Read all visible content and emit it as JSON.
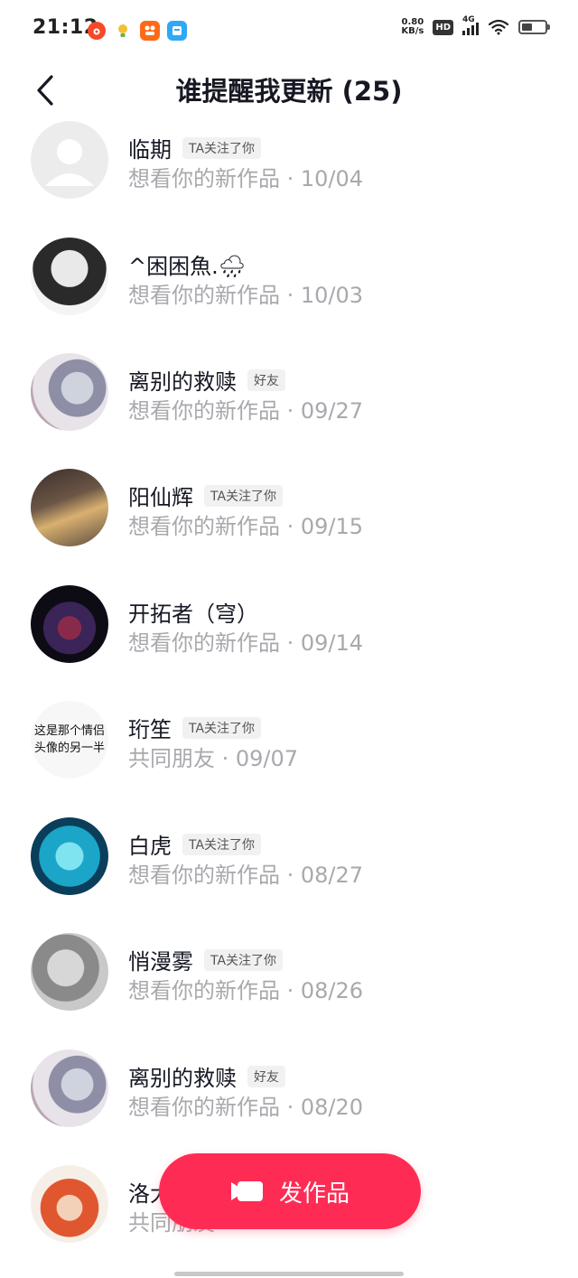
{
  "status_bar": {
    "time": "21:12",
    "net_speed_value": "0.80",
    "net_speed_unit": "KB/s",
    "hd": "HD",
    "network": "4G",
    "notification_icons": [
      "weibo-icon",
      "lightbulb-icon",
      "app-icon",
      "app-icon"
    ]
  },
  "header": {
    "back_icon": "chevron-left-icon",
    "title": "谁提醒我更新 (25)"
  },
  "list": [
    {
      "name": "临期",
      "tag": "TA关注了你",
      "subtitle": "想看你的新作品 · 10/04"
    },
    {
      "name": "^困困魚.🌧",
      "tag": "",
      "subtitle": "想看你的新作品 · 10/03"
    },
    {
      "name": "离别的救赎",
      "tag": "好友",
      "subtitle": "想看你的新作品 · 09/27"
    },
    {
      "name": "阳仙辉",
      "tag": "TA关注了你",
      "subtitle": "想看你的新作品 · 09/15"
    },
    {
      "name": "开拓者（穹）",
      "tag": "",
      "subtitle": "想看你的新作品 · 09/14"
    },
    {
      "name": "珩笙",
      "tag": "TA关注了你",
      "subtitle": "共同朋友 · 09/07",
      "avatar_text_1": "这是那个情侣",
      "avatar_text_2": "头像的另一半"
    },
    {
      "name": "白虎",
      "tag": "TA关注了你",
      "subtitle": "想看你的新作品 · 08/27"
    },
    {
      "name": "悄漫雾",
      "tag": "TA关注了你",
      "subtitle": "想看你的新作品 · 08/26"
    },
    {
      "name": "离别的救赎",
      "tag": "好友",
      "subtitle": "想看你的新作品 · 08/20"
    },
    {
      "name": "洛大",
      "tag": "",
      "subtitle": "共同朋友"
    }
  ],
  "publish_button": {
    "label": "发作品",
    "icon": "video-camera-icon",
    "color": "#fe2c55"
  }
}
